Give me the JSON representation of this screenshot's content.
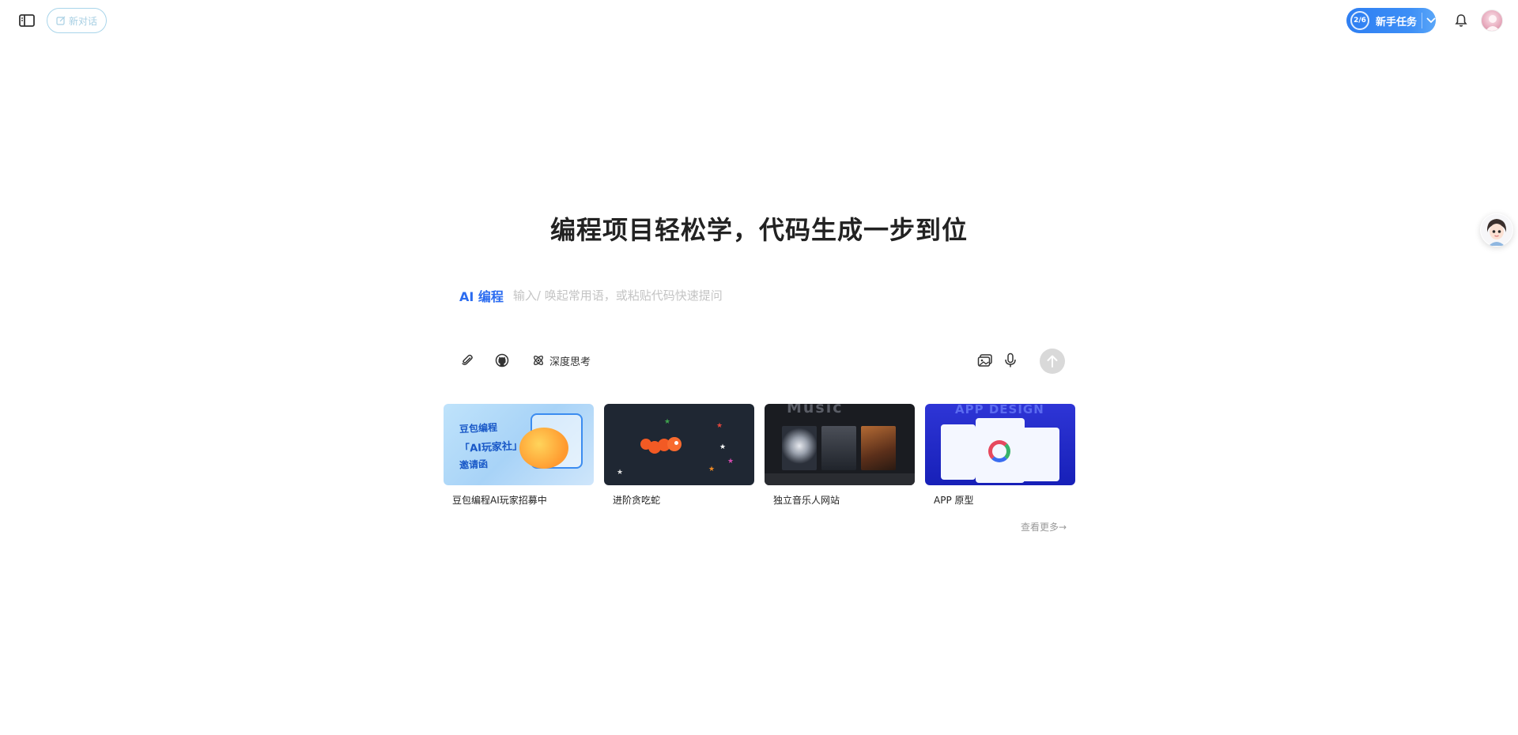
{
  "header": {
    "new_chat_label": "新对话",
    "task_progress": "2/6",
    "task_label": "新手任务"
  },
  "hero": {
    "title": "编程项目轻松学，代码生成一步到位"
  },
  "prompt": {
    "mode_label": "AI 编程",
    "placeholder": "输入/ 唤起常用语，或粘贴代码快速提问",
    "value": ""
  },
  "toolbar": {
    "deep_think_label": "深度思考"
  },
  "cards": [
    {
      "label": "豆包编程AI玩家招募中",
      "thumb_text": [
        "豆包编程",
        "「AI玩家社」",
        "邀请函"
      ]
    },
    {
      "label": "进阶贪吃蛇"
    },
    {
      "label": "独立音乐人网站",
      "thumb_text": [
        "Music"
      ]
    },
    {
      "label": "APP 原型",
      "thumb_text": [
        "APP DESIGN"
      ]
    }
  ],
  "view_more_label": "查看更多→",
  "colors": {
    "accent": "#2b6cf0",
    "task_pill": "#3c8ef6",
    "send_disabled": "#d9d9d9"
  },
  "icons": {
    "sidebar": "sidebar-toggle-icon",
    "new_chat": "edit-icon",
    "bell": "bell-icon",
    "attach": "paperclip-icon",
    "github": "github-icon",
    "deep_think": "atom-icon",
    "screenshot": "image-icon",
    "mic": "mic-icon",
    "send": "arrow-up-icon"
  }
}
